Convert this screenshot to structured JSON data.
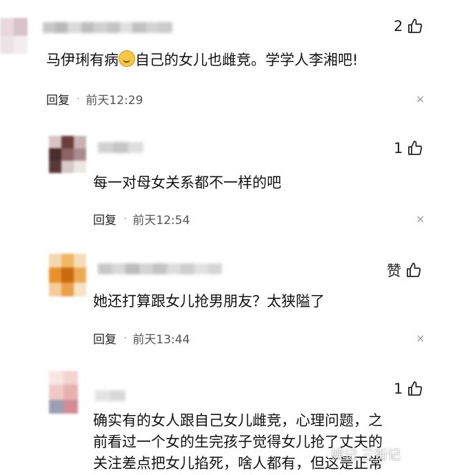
{
  "comments": [
    {
      "likes": "2",
      "text_before": "马伊琍有病",
      "emoji": "grinning-face-emoji",
      "text_after": "自己的女儿也雌竞。学学人李湘吧!",
      "reply_label": "回复",
      "separator": "·",
      "time": "前天12:29",
      "close": "×"
    },
    {
      "likes": "1",
      "text": "每一对母女关系都不一样的吧",
      "reply_label": "回复",
      "separator": "·",
      "time": "前天12:54",
      "close": "×"
    },
    {
      "likes": "赞",
      "text": "她还打算跟女儿抢男朋友？太狭隘了",
      "reply_label": "回复",
      "separator": "·",
      "time": "前天13:44",
      "close": "×"
    },
    {
      "likes": "1",
      "lines": [
        "确实有的女人跟自己女儿雌竞，心理问题，之",
        "前看过一个女的生完孩子觉得女儿抢了丈夫的",
        "关注差点把女儿掐死，啥人都有，但这是正常"
      ]
    }
  ],
  "watermark": "娱记 三街记",
  "icons": {
    "like": "thumbs-up-icon",
    "close": "close-icon"
  }
}
